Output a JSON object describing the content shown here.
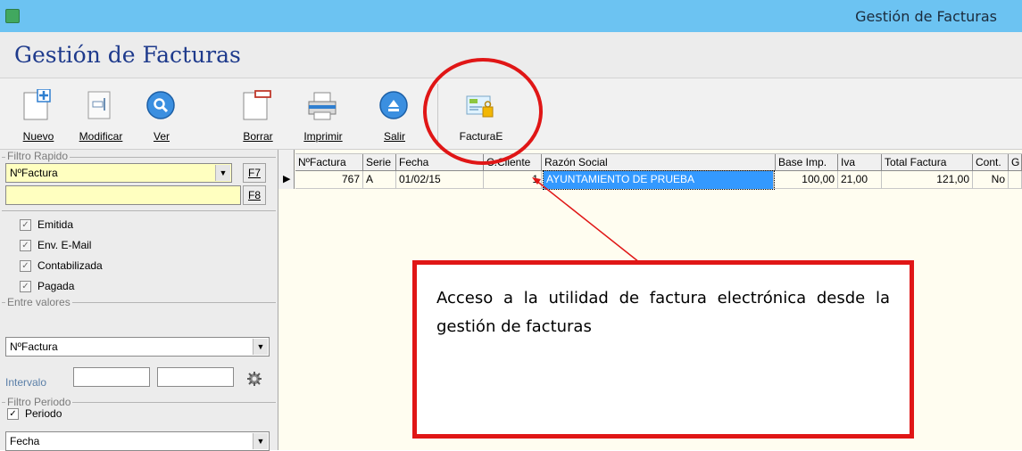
{
  "window": {
    "title": "Gestión de Facturas"
  },
  "page": {
    "title": "Gestión de Facturas"
  },
  "toolbar": {
    "buttons": [
      {
        "label": "Nuevo",
        "icon": "new-document-icon"
      },
      {
        "label": "Modificar",
        "icon": "edit-document-icon"
      },
      {
        "label": "Ver",
        "icon": "search-icon"
      },
      {
        "label": "Borrar",
        "icon": "delete-document-icon"
      },
      {
        "label": "Imprimir",
        "icon": "printer-icon"
      },
      {
        "label": "Salir",
        "icon": "eject-icon"
      },
      {
        "label": "FacturaE",
        "icon": "e-invoice-icon"
      }
    ]
  },
  "quick_filter": {
    "title": "Filtro Rapido",
    "field": "NºFactura",
    "value": "",
    "f7": "F7",
    "f8": "F8"
  },
  "checks": [
    {
      "label": "Emitida",
      "checked": true
    },
    {
      "label": "Env. E-Mail",
      "checked": true
    },
    {
      "label": "Contabilizada",
      "checked": true
    },
    {
      "label": "Pagada",
      "checked": true
    }
  ],
  "range_filter": {
    "title": "Entre valores",
    "field": "NºFactura",
    "interval_label": "Intervalo",
    "from": "",
    "to": ""
  },
  "period_filter": {
    "title": "Filtro Periodo",
    "period_label": "Periodo",
    "period_checked": true,
    "field": "Fecha"
  },
  "table": {
    "headers": [
      "NºFactura",
      "Serie",
      "Fecha",
      "C.Cliente",
      "Razón Social",
      "Base Imp.",
      "Iva",
      "Total Factura",
      "Cont.",
      "G"
    ],
    "rows": [
      [
        "767",
        "A",
        "01/02/15",
        "1",
        "AYUNTAMIENTO DE PRUEBA",
        "100,00",
        "21,00",
        "121,00",
        "No",
        ""
      ]
    ]
  },
  "annotation": {
    "text": "Acceso a la utilidad de factura electrónica desde la gestión de facturas",
    "color": "#e01616"
  }
}
